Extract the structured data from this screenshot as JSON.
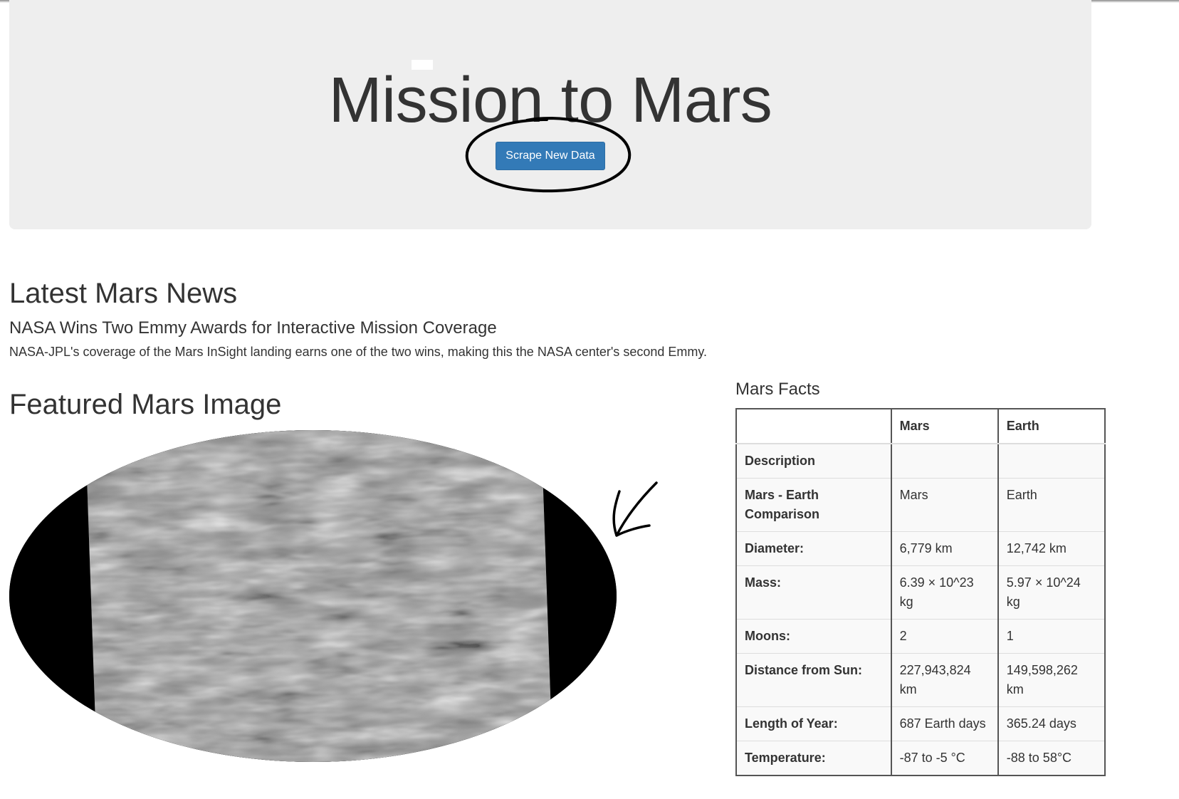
{
  "header": {
    "title": "Mission to Mars",
    "scrape_button_label": "Scrape New Data"
  },
  "news": {
    "heading": "Latest Mars News",
    "title": "NASA Wins Two Emmy Awards for Interactive Mission Coverage",
    "teaser": "NASA-JPL's coverage of the Mars InSight landing earns one of the two wins, making this the NASA center's second Emmy."
  },
  "featured_image": {
    "heading": "Featured Mars Image",
    "description": "grayscale Mars dune field surface image"
  },
  "facts": {
    "heading": "Mars Facts",
    "columns": [
      "",
      "Mars",
      "Earth"
    ],
    "rows": [
      {
        "label": "Description",
        "mars": "",
        "earth": ""
      },
      {
        "label": "Mars - Earth Comparison",
        "mars": "Mars",
        "earth": "Earth"
      },
      {
        "label": "Diameter:",
        "mars": "6,779 km",
        "earth": "12,742 km"
      },
      {
        "label": "Mass:",
        "mars": "6.39 × 10^23 kg",
        "earth": "5.97 × 10^24 kg"
      },
      {
        "label": "Moons:",
        "mars": "2",
        "earth": "1"
      },
      {
        "label": "Distance from Sun:",
        "mars": "227,943,824 km",
        "earth": "149,598,262 km"
      },
      {
        "label": "Length of Year:",
        "mars": "687 Earth days",
        "earth": "365.24 days"
      },
      {
        "label": "Temperature:",
        "mars": "-87 to -5 °C",
        "earth": "-88 to 58°C"
      }
    ]
  },
  "colors": {
    "button": "#337ab7",
    "jumbotron": "#eeeeee",
    "text": "#333333",
    "annotation_ink": "#000000"
  }
}
